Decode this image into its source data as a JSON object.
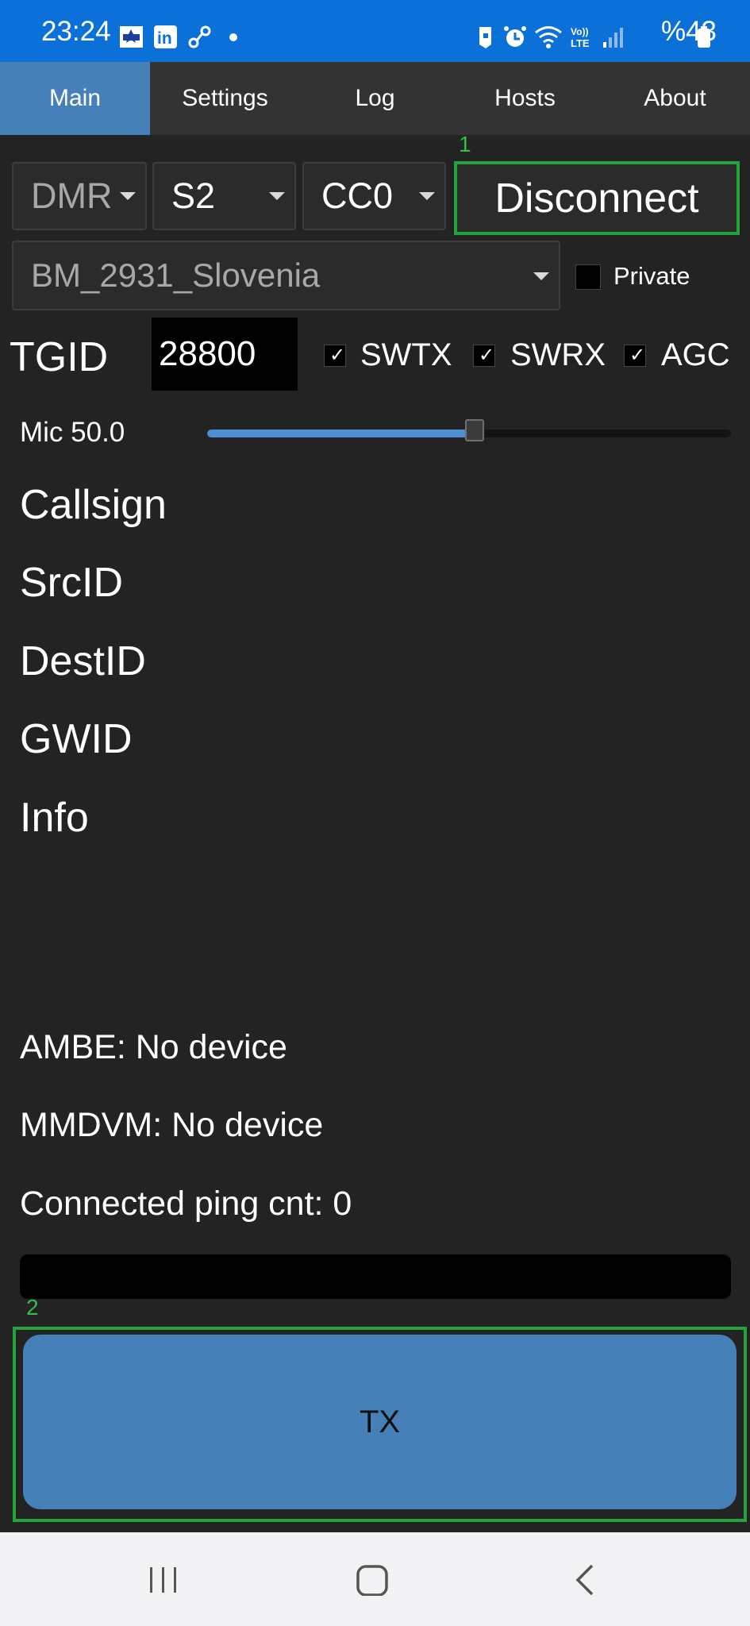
{
  "status_bar": {
    "time": "23:24",
    "battery_text": "%43",
    "icons": [
      "flag-icon",
      "linkedin-icon",
      "link-icon",
      "dot-icon",
      "shield-icon",
      "alarm-icon",
      "wifi-icon",
      "volte-icon",
      "signal-icon",
      "battery-icon"
    ]
  },
  "tabs": [
    {
      "label": "Main",
      "active": true
    },
    {
      "label": "Settings"
    },
    {
      "label": "Log"
    },
    {
      "label": "Hosts"
    },
    {
      "label": "About"
    }
  ],
  "controls": {
    "mode_value": "DMR",
    "slot_value": "S2",
    "cc_value": "CC0",
    "disconnect_label": "Disconnect",
    "marker1": "1",
    "host_value": "BM_2931_Slovenia",
    "private_label": "Private",
    "tgid_label": "TGID",
    "tgid_value": "28800",
    "swtx_label": "SWTX",
    "swrx_label": "SWRX",
    "agc_label": "AGC",
    "check_mark": "✓",
    "mic_label": "Mic 50.0",
    "mic_level": 0.5
  },
  "info": {
    "callsign": "Callsign",
    "srcid": "SrcID",
    "destid": "DestID",
    "gwid": "GWID",
    "info": "Info"
  },
  "status": {
    "ambe": "AMBE: No device",
    "mmdvm": "MMDVM: No device",
    "ping": "Connected ping cnt: 0"
  },
  "tx": {
    "marker2": "2",
    "label": "TX"
  },
  "colors": {
    "status_bar_bg": "#0b71d9",
    "accent_blue": "#4581b8",
    "highlight_green": "#22a43b",
    "background": "#232323"
  }
}
